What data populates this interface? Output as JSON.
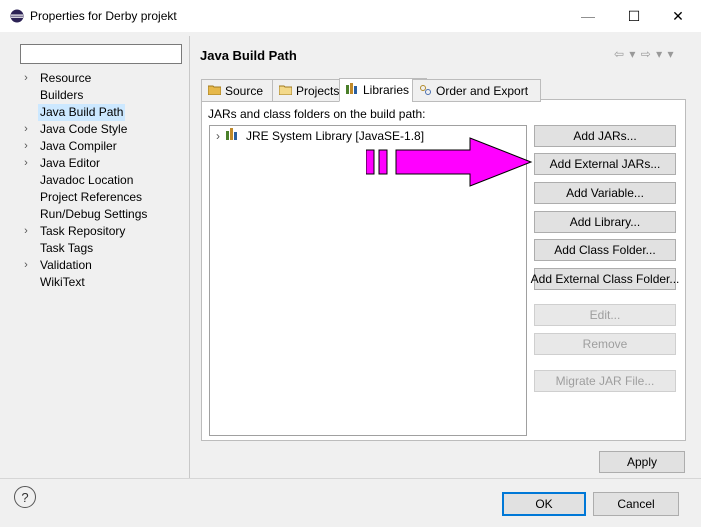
{
  "window": {
    "title": "Properties for Derby projekt",
    "minimize": "—",
    "maximize": "☐",
    "close": "✕"
  },
  "filter": {
    "value": "",
    "placeholder": ""
  },
  "tree": [
    {
      "label": "Resource",
      "expandable": true
    },
    {
      "label": "Builders",
      "expandable": false
    },
    {
      "label": "Java Build Path",
      "expandable": false,
      "selected": true
    },
    {
      "label": "Java Code Style",
      "expandable": true
    },
    {
      "label": "Java Compiler",
      "expandable": true
    },
    {
      "label": "Java Editor",
      "expandable": true
    },
    {
      "label": "Javadoc Location",
      "expandable": false
    },
    {
      "label": "Project References",
      "expandable": false
    },
    {
      "label": "Run/Debug Settings",
      "expandable": false
    },
    {
      "label": "Task Repository",
      "expandable": true
    },
    {
      "label": "Task Tags",
      "expandable": false
    },
    {
      "label": "Validation",
      "expandable": true
    },
    {
      "label": "WikiText",
      "expandable": false
    }
  ],
  "page": {
    "title": "Java Build Path",
    "nav_arrows": "⇦ ▾ ⇨ ▾ ▾"
  },
  "tabs": [
    {
      "label": "Source",
      "icon": "source-folder-icon"
    },
    {
      "label": "Projects",
      "icon": "projects-folder-icon"
    },
    {
      "label": "Libraries",
      "icon": "libraries-icon",
      "active": true
    },
    {
      "label": "Order and Export",
      "icon": "order-export-icon"
    }
  ],
  "libraries": {
    "label": "JARs and class folders on the build path:",
    "entries": [
      {
        "label": "JRE System Library [JavaSE-1.8]",
        "icon": "jre-library-icon"
      }
    ]
  },
  "buttons": {
    "add_jars": "Add JARs...",
    "add_external_jars": "Add External JARs...",
    "add_variable": "Add Variable...",
    "add_library": "Add Library...",
    "add_class_folder": "Add Class Folder...",
    "add_external_class_folder": "Add External Class Folder...",
    "edit": "Edit...",
    "remove": "Remove",
    "migrate_jar": "Migrate JAR File...",
    "apply": "Apply",
    "ok": "OK",
    "cancel": "Cancel"
  },
  "help": "?",
  "colors": {
    "annotation_arrow": "#ff00ff",
    "selection": "#cce8ff",
    "ok_border": "#0078d7"
  }
}
